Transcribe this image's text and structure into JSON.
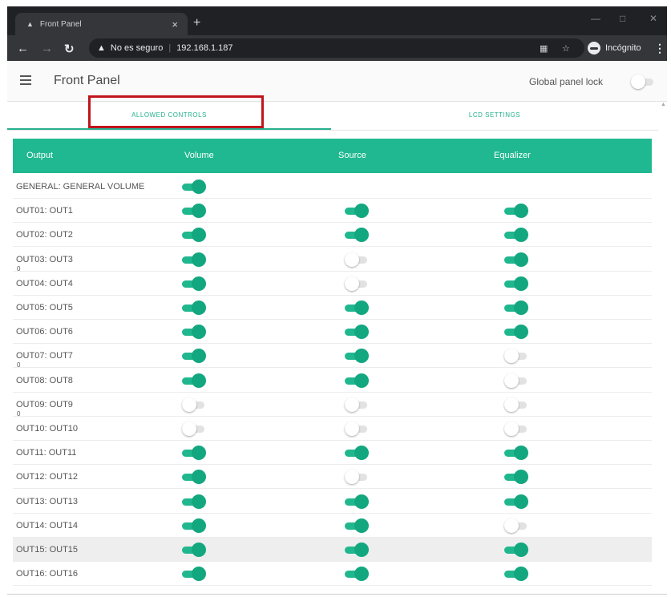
{
  "browser": {
    "tab_title": "Front Panel",
    "tab_close": "×",
    "new_tab": "+",
    "security_label": "No es seguro",
    "url": "192.168.1.187",
    "incognito_label": "Incógnito"
  },
  "app": {
    "title": "Front Panel",
    "global_lock_label": "Global panel lock",
    "global_lock_on": false
  },
  "tabs": [
    {
      "label": "ALLOWED CONTROLS",
      "active": true
    },
    {
      "label": "LCD SETTINGS",
      "active": false
    }
  ],
  "table": {
    "headers": [
      "Output",
      "Volume",
      "Source",
      "Equalizer"
    ],
    "rows": [
      {
        "label": "GENERAL: GENERAL VOLUME",
        "volume": true,
        "source": null,
        "equalizer": null,
        "mark": ""
      },
      {
        "label": "OUT01: OUT1",
        "volume": true,
        "source": true,
        "equalizer": true,
        "mark": ""
      },
      {
        "label": "OUT02: OUT2",
        "volume": true,
        "source": true,
        "equalizer": true,
        "mark": ""
      },
      {
        "label": "OUT03: OUT3",
        "volume": true,
        "source": false,
        "equalizer": true,
        "mark": "0"
      },
      {
        "label": "OUT04: OUT4",
        "volume": true,
        "source": false,
        "equalizer": true,
        "mark": ""
      },
      {
        "label": "OUT05: OUT5",
        "volume": true,
        "source": true,
        "equalizer": true,
        "mark": ""
      },
      {
        "label": "OUT06: OUT6",
        "volume": true,
        "source": true,
        "equalizer": true,
        "mark": ""
      },
      {
        "label": "OUT07: OUT7",
        "volume": true,
        "source": true,
        "equalizer": false,
        "mark": "0"
      },
      {
        "label": "OUT08: OUT8",
        "volume": true,
        "source": true,
        "equalizer": false,
        "mark": ""
      },
      {
        "label": "OUT09: OUT9",
        "volume": false,
        "source": false,
        "equalizer": false,
        "mark": "0"
      },
      {
        "label": "OUT10: OUT10",
        "volume": false,
        "source": false,
        "equalizer": false,
        "mark": ""
      },
      {
        "label": "OUT11: OUT11",
        "volume": true,
        "source": true,
        "equalizer": true,
        "mark": ""
      },
      {
        "label": "OUT12: OUT12",
        "volume": true,
        "source": false,
        "equalizer": true,
        "mark": ""
      },
      {
        "label": "OUT13: OUT13",
        "volume": true,
        "source": true,
        "equalizer": true,
        "mark": ""
      },
      {
        "label": "OUT14: OUT14",
        "volume": true,
        "source": true,
        "equalizer": false,
        "mark": ""
      },
      {
        "label": "OUT15: OUT15",
        "volume": true,
        "source": true,
        "equalizer": true,
        "mark": "",
        "shaded": true
      },
      {
        "label": "OUT16: OUT16",
        "volume": true,
        "source": true,
        "equalizer": true,
        "mark": ""
      }
    ]
  },
  "colors": {
    "accent": "#20b890",
    "highlight_box": "#c0151b"
  },
  "icons": [
    "back-icon",
    "forward-icon",
    "reload-icon",
    "warning-icon",
    "translate-icon",
    "star-icon",
    "incognito-icon",
    "menu-icon",
    "hamburger-icon"
  ]
}
